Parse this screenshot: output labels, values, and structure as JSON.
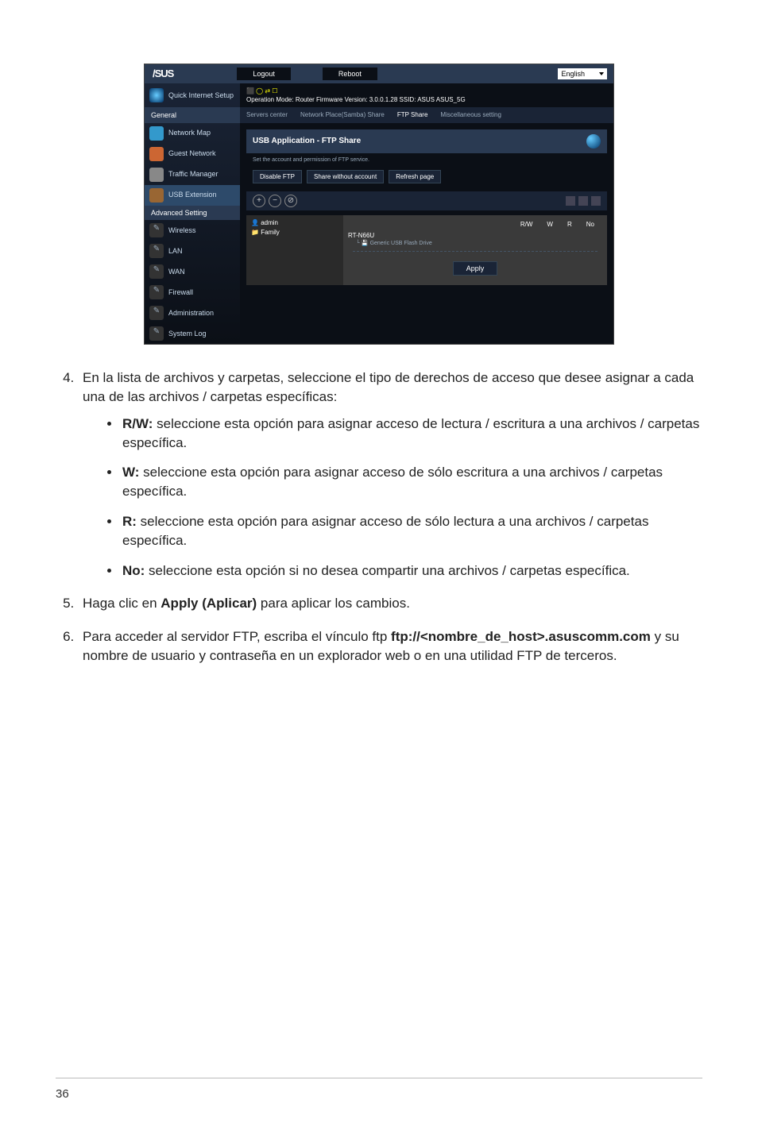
{
  "screenshot": {
    "logo": "/SUS",
    "logout": "Logout",
    "reboot": "Reboot",
    "lang": "English",
    "qis": "Quick Internet Setup",
    "section_general": "General",
    "nav_map": "Network Map",
    "nav_guest": "Guest Network",
    "nav_traffic": "Traffic Manager",
    "nav_usb": "USB Extension",
    "section_adv": "Advanced Setting",
    "nav_wireless": "Wireless",
    "nav_lan": "LAN",
    "nav_wan": "WAN",
    "nav_fw": "Firewall",
    "nav_admin": "Administration",
    "nav_log": "System Log",
    "hdr_mode": "Operation Mode: Router    Firmware Version: 3.0.0.1.28    SSID: ASUS   ASUS_5G",
    "tab_srv": "Servers center",
    "tab_np": "Network Place(Samba) Share",
    "tab_ftp": "FTP Share",
    "tab_misc": "Miscellaneous setting",
    "panel_title": "USB Application - FTP Share",
    "panel_sub": "Set the account and permission of FTP service.",
    "btn_disable": "Disable FTP",
    "btn_sharewo": "Share without account",
    "btn_refresh": "Refresh page",
    "user_admin": "admin",
    "user_family": "Family",
    "rt": "RT-N66U",
    "drive": "Generic USB Flash Drive",
    "perm_rw": "R/W",
    "perm_w": "W",
    "perm_r": "R",
    "perm_no": "No",
    "apply": "Apply"
  },
  "list": {
    "item4_intro": "En la lista de archivos y carpetas, seleccione el tipo de derechos de acceso que desee asignar a cada una de las archivos / carpetas específicas:",
    "rw_label": "R/W:",
    "rw_text": " seleccione esta opción para asignar acceso de lectura / escritura a una archivos / carpetas específica.",
    "w_label": "W:",
    "w_text": " seleccione esta opción para asignar acceso de sólo escritura a una archivos / carpetas específica.",
    "r_label": "R:",
    "r_text": " seleccione esta opción para asignar acceso de sólo lectura a una archivos / carpetas específica.",
    "no_label": "No:",
    "no_text": " seleccione esta opción si no desea compartir una archivos / carpetas específica.",
    "item5_a": "Haga clic en ",
    "item5_b": "Apply (Aplicar)",
    "item5_c": " para aplicar los cambios.",
    "item6_a": "Para acceder al servidor FTP, escriba el vínculo ftp ",
    "item6_b": "ftp://<nombre_de_host>.asuscomm.com",
    "item6_c": " y su nombre de usuario y contraseña en un explorador web o en una utilidad FTP de terceros."
  },
  "pagenum": "36"
}
